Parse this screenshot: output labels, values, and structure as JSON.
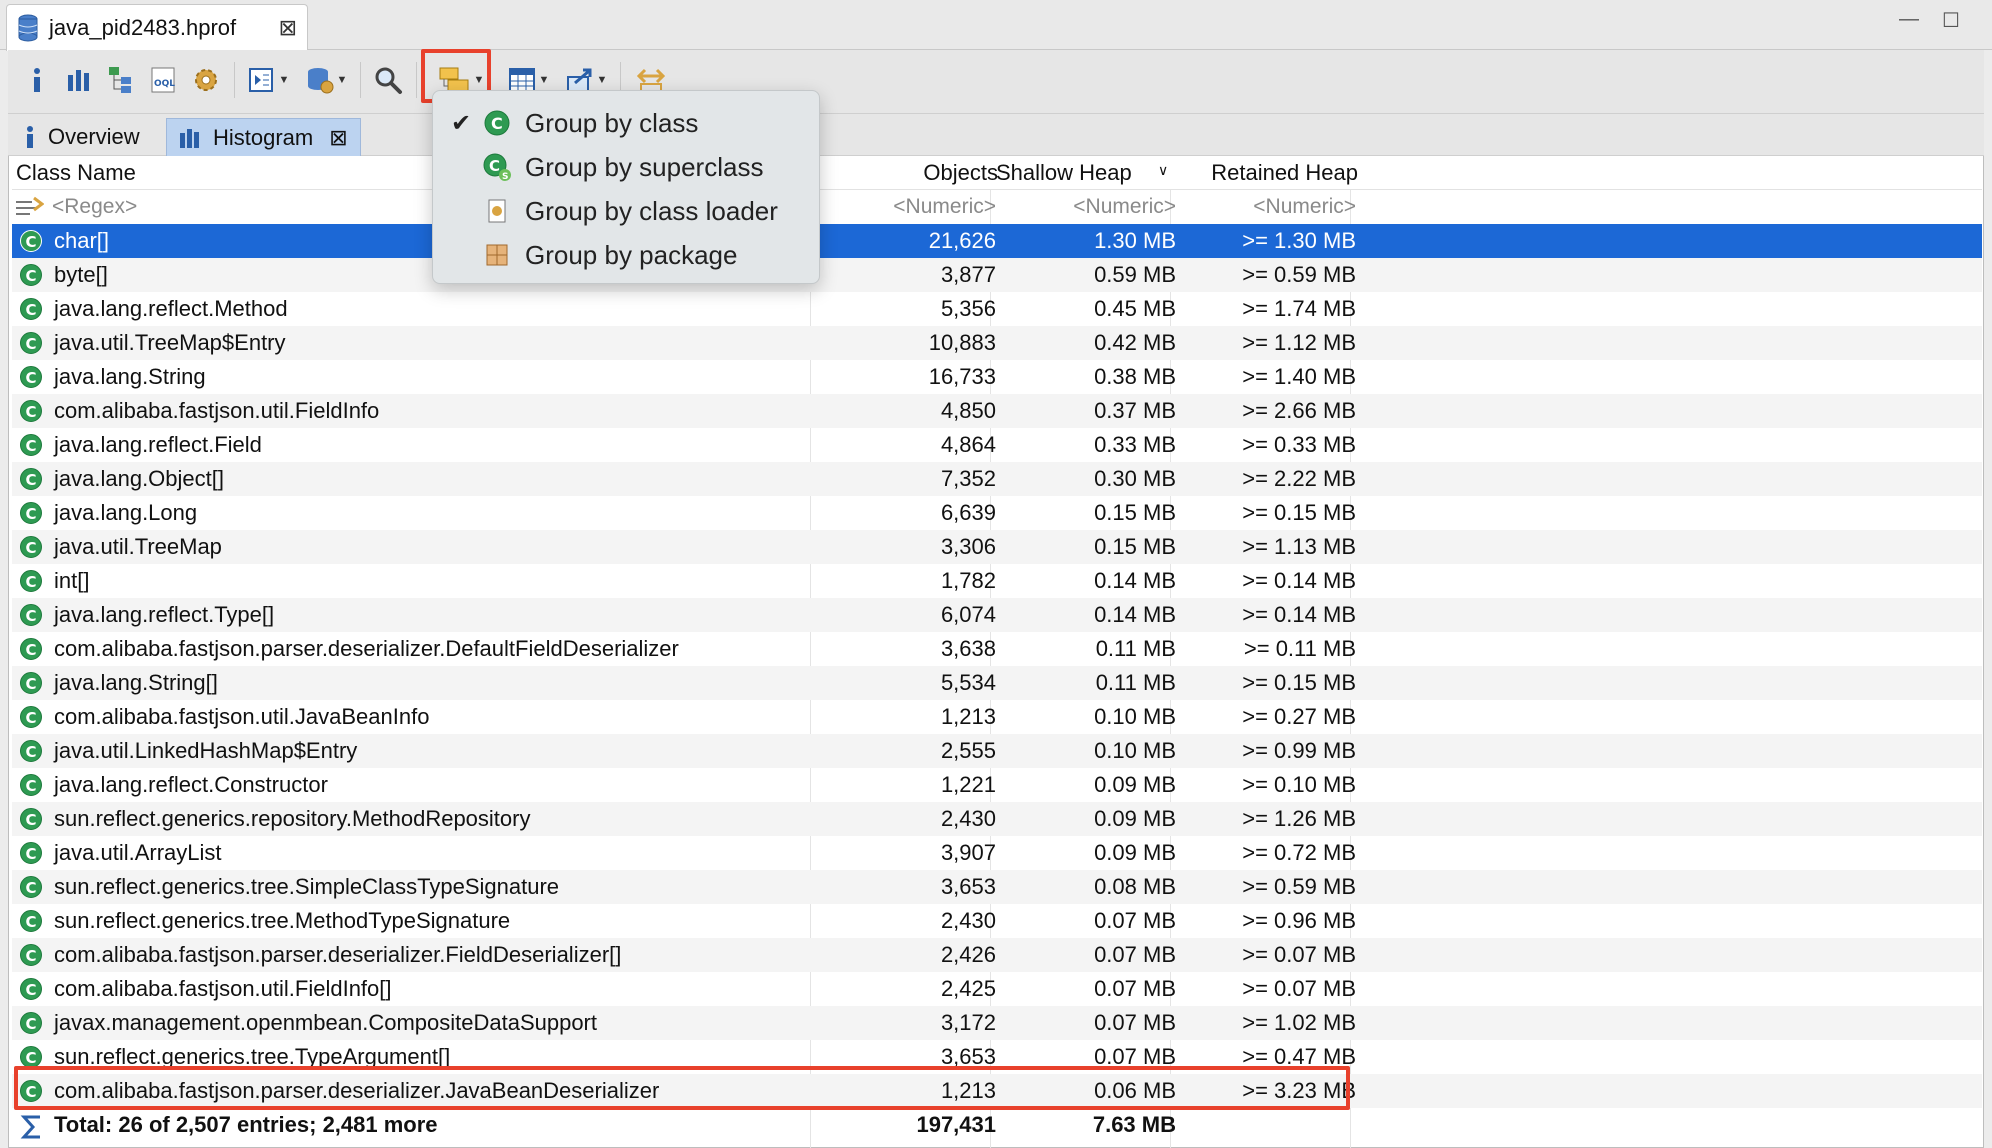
{
  "editor_tab": {
    "title": "java_pid2483.hprof"
  },
  "toolbar": {
    "buttons": [
      "info-icon",
      "histogram-icon",
      "dominator-tree-icon",
      "oql-icon",
      "gear-icon",
      "run-report-icon",
      "query-browser-icon",
      "search-icon",
      "group-by-icon",
      "calculator-icon",
      "export-icon",
      "settings-icon"
    ]
  },
  "inner_tabs": [
    {
      "label": "Overview",
      "active": false
    },
    {
      "label": "Histogram",
      "active": true
    }
  ],
  "group_menu": {
    "items": [
      {
        "label": "Group by class",
        "checked": true
      },
      {
        "label": "Group by superclass",
        "checked": false
      },
      {
        "label": "Group by class loader",
        "checked": false
      },
      {
        "label": "Group by package",
        "checked": false
      }
    ]
  },
  "table": {
    "headers": {
      "class_name": "Class Name",
      "objects": "Objects",
      "shallow_heap": "Shallow Heap",
      "retained_heap": "Retained Heap"
    },
    "filter": {
      "class_name": "<Regex>",
      "objects": "<Numeric>",
      "shallow_heap": "<Numeric>",
      "retained_heap": "<Numeric>"
    },
    "rows": [
      {
        "name": "char[]",
        "objects": "21,626",
        "shallow": "1.30 MB",
        "retained": ">= 1.30 MB"
      },
      {
        "name": "byte[]",
        "objects": "3,877",
        "shallow": "0.59 MB",
        "retained": ">= 0.59 MB"
      },
      {
        "name": "java.lang.reflect.Method",
        "objects": "5,356",
        "shallow": "0.45 MB",
        "retained": ">= 1.74 MB"
      },
      {
        "name": "java.util.TreeMap$Entry",
        "objects": "10,883",
        "shallow": "0.42 MB",
        "retained": ">= 1.12 MB"
      },
      {
        "name": "java.lang.String",
        "objects": "16,733",
        "shallow": "0.38 MB",
        "retained": ">= 1.40 MB"
      },
      {
        "name": "com.alibaba.fastjson.util.FieldInfo",
        "objects": "4,850",
        "shallow": "0.37 MB",
        "retained": ">= 2.66 MB"
      },
      {
        "name": "java.lang.reflect.Field",
        "objects": "4,864",
        "shallow": "0.33 MB",
        "retained": ">= 0.33 MB"
      },
      {
        "name": "java.lang.Object[]",
        "objects": "7,352",
        "shallow": "0.30 MB",
        "retained": ">= 2.22 MB"
      },
      {
        "name": "java.lang.Long",
        "objects": "6,639",
        "shallow": "0.15 MB",
        "retained": ">= 0.15 MB"
      },
      {
        "name": "java.util.TreeMap",
        "objects": "3,306",
        "shallow": "0.15 MB",
        "retained": ">= 1.13 MB"
      },
      {
        "name": "int[]",
        "objects": "1,782",
        "shallow": "0.14 MB",
        "retained": ">= 0.14 MB"
      },
      {
        "name": "java.lang.reflect.Type[]",
        "objects": "6,074",
        "shallow": "0.14 MB",
        "retained": ">= 0.14 MB"
      },
      {
        "name": "com.alibaba.fastjson.parser.deserializer.DefaultFieldDeserializer",
        "objects": "3,638",
        "shallow": "0.11 MB",
        "retained": ">= 0.11 MB"
      },
      {
        "name": "java.lang.String[]",
        "objects": "5,534",
        "shallow": "0.11 MB",
        "retained": ">= 0.15 MB"
      },
      {
        "name": "com.alibaba.fastjson.util.JavaBeanInfo",
        "objects": "1,213",
        "shallow": "0.10 MB",
        "retained": ">= 0.27 MB"
      },
      {
        "name": "java.util.LinkedHashMap$Entry",
        "objects": "2,555",
        "shallow": "0.10 MB",
        "retained": ">= 0.99 MB"
      },
      {
        "name": "java.lang.reflect.Constructor",
        "objects": "1,221",
        "shallow": "0.09 MB",
        "retained": ">= 0.10 MB"
      },
      {
        "name": "sun.reflect.generics.repository.MethodRepository",
        "objects": "2,430",
        "shallow": "0.09 MB",
        "retained": ">= 1.26 MB"
      },
      {
        "name": "java.util.ArrayList",
        "objects": "3,907",
        "shallow": "0.09 MB",
        "retained": ">= 0.72 MB"
      },
      {
        "name": "sun.reflect.generics.tree.SimpleClassTypeSignature",
        "objects": "3,653",
        "shallow": "0.08 MB",
        "retained": ">= 0.59 MB"
      },
      {
        "name": "sun.reflect.generics.tree.MethodTypeSignature",
        "objects": "2,430",
        "shallow": "0.07 MB",
        "retained": ">= 0.96 MB"
      },
      {
        "name": "com.alibaba.fastjson.parser.deserializer.FieldDeserializer[]",
        "objects": "2,426",
        "shallow": "0.07 MB",
        "retained": ">= 0.07 MB"
      },
      {
        "name": "com.alibaba.fastjson.util.FieldInfo[]",
        "objects": "2,425",
        "shallow": "0.07 MB",
        "retained": ">= 0.07 MB"
      },
      {
        "name": "javax.management.openmbean.CompositeDataSupport",
        "objects": "3,172",
        "shallow": "0.07 MB",
        "retained": ">= 1.02 MB"
      },
      {
        "name": "sun.reflect.generics.tree.TypeArgument[]",
        "objects": "3,653",
        "shallow": "0.07 MB",
        "retained": ">= 0.47 MB"
      },
      {
        "name": "com.alibaba.fastjson.parser.deserializer.JavaBeanDeserializer",
        "objects": "1,213",
        "shallow": "0.06 MB",
        "retained": ">= 3.23 MB"
      }
    ],
    "total": {
      "label": "Total: 26 of 2,507 entries; 2,481 more",
      "objects": "197,431",
      "shallow": "7.63 MB"
    }
  },
  "colors": {
    "selection": "#1c68d6",
    "highlight": "#e8412c",
    "class_icon": "#2e9a52"
  }
}
